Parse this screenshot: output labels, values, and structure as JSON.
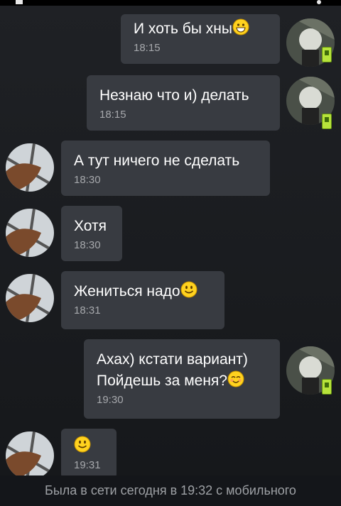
{
  "messages": [
    {
      "side": "right",
      "text": "И хоть бы хны",
      "emoji": "grin",
      "time": "18:15"
    },
    {
      "side": "right",
      "text": "Незнаю что и) делать",
      "time": "18:15"
    },
    {
      "side": "left",
      "text": "А тут ничего не сделать",
      "time": "18:30"
    },
    {
      "side": "left",
      "text": "Хотя",
      "time": "18:30"
    },
    {
      "side": "left",
      "text": "Жениться надо",
      "emoji": "smile",
      "time": "18:31"
    },
    {
      "side": "right",
      "text": "Ахах) кстати вариант)",
      "text2": "Пойдешь за меня?",
      "emoji": "blush",
      "time": "19:30"
    },
    {
      "side": "left",
      "text": "",
      "emoji": "smile",
      "time": "19:31"
    }
  ],
  "status": {
    "last_seen": "Была в сети сегодня в 19:32 с мобильного"
  },
  "colors": {
    "bubble": "#383b41",
    "background": "#1d1f22",
    "time": "#a6a8ac",
    "emoji": "#ffd21f"
  }
}
